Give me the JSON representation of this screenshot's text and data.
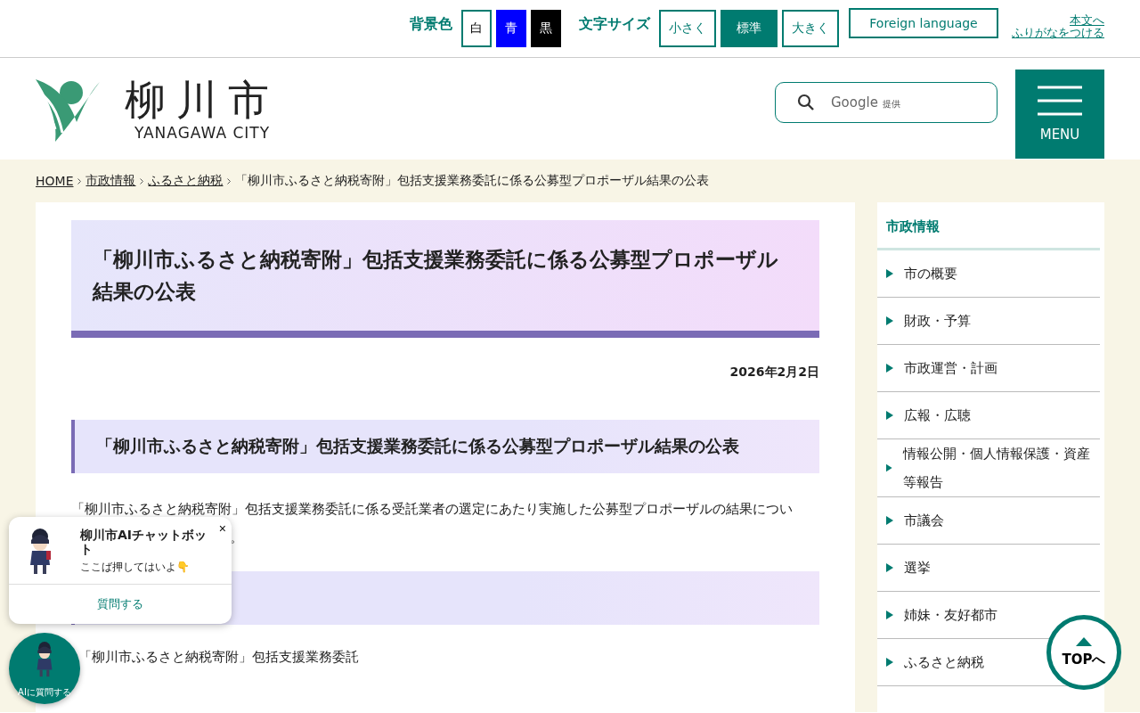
{
  "utility_bar": {
    "bg_label": "背景色",
    "bg_options": [
      {
        "label": "白",
        "kind": "white",
        "selected": false
      },
      {
        "label": "青",
        "kind": "blue",
        "selected": false
      },
      {
        "label": "黒",
        "kind": "black",
        "selected": false
      }
    ],
    "size_label": "文字サイズ",
    "size_options": [
      {
        "label": "小さく",
        "selected": false
      },
      {
        "label": "標準",
        "selected": true
      },
      {
        "label": "大きく",
        "selected": false
      }
    ],
    "foreign_language": "Foreign language",
    "skip_link": "本文へ",
    "furigana_link": "ふりがなをつける"
  },
  "header": {
    "logo_name": "柳川市",
    "logo_sub": "YANAGAWA CITY",
    "search_brand": "Google",
    "search_suffix": "提供",
    "menu_label": "MENU"
  },
  "breadcrumb": [
    {
      "label": "HOME",
      "link": true
    },
    {
      "label": "市政情報",
      "link": true
    },
    {
      "label": "ふるさと納税",
      "link": true
    },
    {
      "label": "「柳川市ふるさと納税寄附」包括支援業務委託に係る公募型プロポーザル結果の公表",
      "link": false
    }
  ],
  "article": {
    "title": "「柳川市ふるさと納税寄附」包括支援業務委託に係る公募型プロポーザル結果の公表",
    "date": "2026年2月2日",
    "heading_1": "「柳川市ふるさと納税寄附」包括支援業務委託に係る公募型プロポーザル結果の公表",
    "paragraph_line_1": "「柳川市ふるさと納税寄附」包括支援業務委託に係る受託業者の選定にあたり実施した公募型プロポーザルの結果につい",
    "paragraph_line_2_tail": "。",
    "body_text": "「柳川市ふるさと納税寄附」包括支援業務委託"
  },
  "sidebar": {
    "heading": "市政情報",
    "items": [
      "市の概要",
      "財政・予算",
      "市政運営・計画",
      "広報・広聴",
      "情報公開・個人情報保護・資産等報告",
      "市議会",
      "選挙",
      "姉妹・友好都市",
      "ふるさと納税"
    ]
  },
  "chatbot": {
    "title": "柳川市AIチャットボット",
    "message": "ここば押してはいよ👇",
    "close": "×",
    "action": "質問する",
    "launcher_label": "AIに質問する"
  },
  "back_to_top": "TOPへ"
}
